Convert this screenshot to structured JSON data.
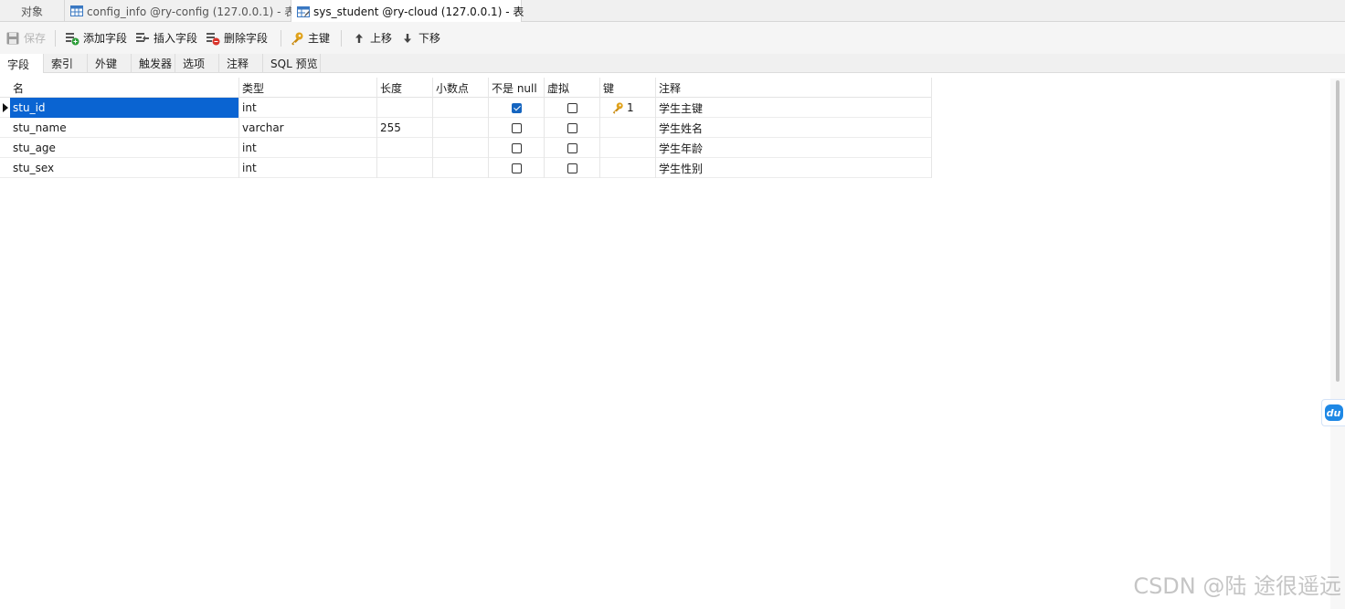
{
  "doc_tabs": [
    {
      "label": "对象"
    },
    {
      "label": "config_info @ry-config (127.0.0.1) - 表"
    },
    {
      "label": "sys_student @ry-cloud (127.0.0.1) - 表"
    }
  ],
  "toolbar": {
    "save": "保存",
    "add_field": "添加字段",
    "insert_field": "插入字段",
    "delete_field": "删除字段",
    "primary_key": "主键",
    "move_up": "上移",
    "move_down": "下移"
  },
  "sub_tabs": [
    "字段",
    "索引",
    "外键",
    "触发器",
    "选项",
    "注释",
    "SQL 预览"
  ],
  "grid": {
    "headers": {
      "name": "名",
      "type": "类型",
      "length": "长度",
      "decimals": "小数点",
      "not_null": "不是 null",
      "virtual": "虚拟",
      "key": "键",
      "comment": "注释"
    },
    "rows": [
      {
        "name": "stu_id",
        "type": "int",
        "length": "",
        "decimals": "",
        "not_null": true,
        "virtual": false,
        "key": "1",
        "comment": "学生主键"
      },
      {
        "name": "stu_name",
        "type": "varchar",
        "length": "255",
        "decimals": "",
        "not_null": false,
        "virtual": false,
        "key": "",
        "comment": "学生姓名"
      },
      {
        "name": "stu_age",
        "type": "int",
        "length": "",
        "decimals": "",
        "not_null": false,
        "virtual": false,
        "key": "",
        "comment": "学生年龄"
      },
      {
        "name": "stu_sex",
        "type": "int",
        "length": "",
        "decimals": "",
        "not_null": false,
        "virtual": false,
        "key": "",
        "comment": "学生性别"
      }
    ]
  },
  "side_badge": {
    "label": "du"
  },
  "watermark": "CSDN @陆 途很遥远",
  "icons": {
    "table": "table-icon",
    "table_edit": "table-edit-icon",
    "save": "save-icon",
    "add": "add-field-icon",
    "insert": "insert-field-icon",
    "delete": "delete-field-icon",
    "key": "key-icon",
    "up": "arrow-up-icon",
    "down": "arrow-down-icon"
  },
  "colors": {
    "selection": "#0a64d2",
    "check": "#1565c0",
    "key": "#e0a21b",
    "add_green": "#2e9e3a",
    "delete_red": "#d9342b"
  }
}
